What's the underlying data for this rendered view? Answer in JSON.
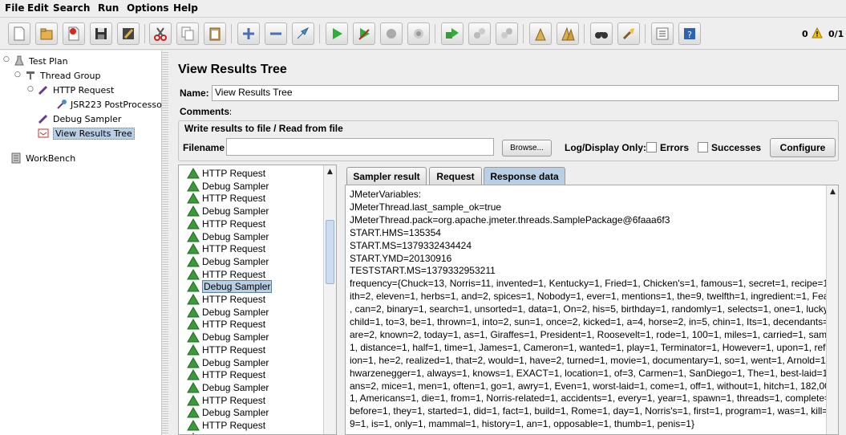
{
  "menu": [
    "File",
    "Edit",
    "Search",
    "Run",
    "Options",
    "Help"
  ],
  "status": {
    "warnings": "0",
    "threads": "0/1"
  },
  "tree": {
    "items": [
      {
        "label": "Test Plan",
        "icon": "test-plan-icon"
      },
      {
        "label": "Thread Group",
        "icon": "thread-group-icon"
      },
      {
        "label": "HTTP Request",
        "icon": "sampler-icon"
      },
      {
        "label": "JSR223 PostProcessor",
        "icon": "postprocessor-icon"
      },
      {
        "label": "Debug Sampler",
        "icon": "sampler-icon"
      },
      {
        "label": "View Results Tree",
        "icon": "listener-icon"
      },
      {
        "label": "WorkBench",
        "icon": "workbench-icon"
      }
    ]
  },
  "panel": {
    "title": "View Results Tree",
    "name_label": "Name:",
    "name_value": "View Results Tree",
    "comments_label": "Comments:",
    "file_section_label": "Write results to file / Read from file",
    "filename_label": "Filename",
    "filename_value": "",
    "browse_label": "Browse...",
    "logdisplay_label": "Log/Display Only:",
    "errors_label": "Errors",
    "successes_label": "Successes",
    "configure_label": "Configure"
  },
  "results": [
    "HTTP Request",
    "Debug Sampler",
    "HTTP Request",
    "Debug Sampler",
    "HTTP Request",
    "Debug Sampler",
    "HTTP Request",
    "Debug Sampler",
    "HTTP Request",
    "Debug Sampler",
    "HTTP Request",
    "Debug Sampler",
    "HTTP Request",
    "Debug Sampler",
    "HTTP Request",
    "Debug Sampler",
    "HTTP Request",
    "Debug Sampler",
    "HTTP Request",
    "Debug Sampler",
    "HTTP Request",
    "Debug Sampler"
  ],
  "selected_result_index": 9,
  "tabs": [
    "Sampler result",
    "Request",
    "Response data"
  ],
  "active_tab": 2,
  "response_lines": [
    "JMeterVariables:",
    "JMeterThread.last_sample_ok=true",
    "JMeterThread.pack=org.apache.jmeter.threads.SamplePackage@6faaa6f3",
    "START.HMS=135354",
    "START.MS=1379332434424",
    "START.YMD=20130916",
    "TESTSTART.MS=1379332953211",
    "frequency={Chuck=13, Norris=11, invented=1, Kentucky=1, Fried=1, Chicken's=1, famous=1, secret=1, recipe=1",
    "ith=2, eleven=1, herbs=1, and=2, spices=1, Nobody=1, ever=1, mentions=1, the=9, twelfth=1, ingredient:=1, Fea",
    ", can=2, binary=1, search=1, unsorted=1, data=1, On=2, his=5, birthday=1, randomly=1, selects=1, one=1, lucky=",
    "child=1, to=3, be=1, thrown=1, into=2, sun=1, once=2, kicked=1, a=4, horse=2, in=5, chin=1, Its=1, decendants=",
    "are=2, known=2, today=1, as=1, Giraffes=1, President=1, Roosevelt=1, rode=1, 100=1, miles=1, carried=1, sam",
    "1, distance=1, half=1, time=1, James=1, Cameron=1, wanted=1, play=1, Terminator=1, However=1, upon=1, refl",
    "ion=1, he=2, realized=1, that=2, would=1, have=2, turned=1, movie=1, documentary=1, so=1, went=1, Arnold=1,",
    "hwarzenegger=1, always=1, knows=1, EXACT=1, location=1, of=3, Carmen=1, SanDiego=1, The=1, best-laid=1,",
    "ans=2, mice=1, men=1, often=1, go=1, awry=1, Even=1, worst-laid=1, come=1, off=1, without=1, hitch=1, 182,00",
    "1, Americans=1, die=1, from=1, Norris-related=1, accidents=1, every=1, year=1, spawn=1, threads=1, complete=",
    "before=1, they=1, started=1, did=1, fact=1, build=1, Rome=1, day=1, Norris's=1, first=1, program=1, was=1, kill=",
    "9=1, is=1, only=1, mammal=1, history=1, an=1, opposable=1, thumb=1, penis=1}"
  ],
  "colors": {
    "selection": "#b8cfe5",
    "success": "#3a9a3a",
    "background": "#eeeeee"
  }
}
